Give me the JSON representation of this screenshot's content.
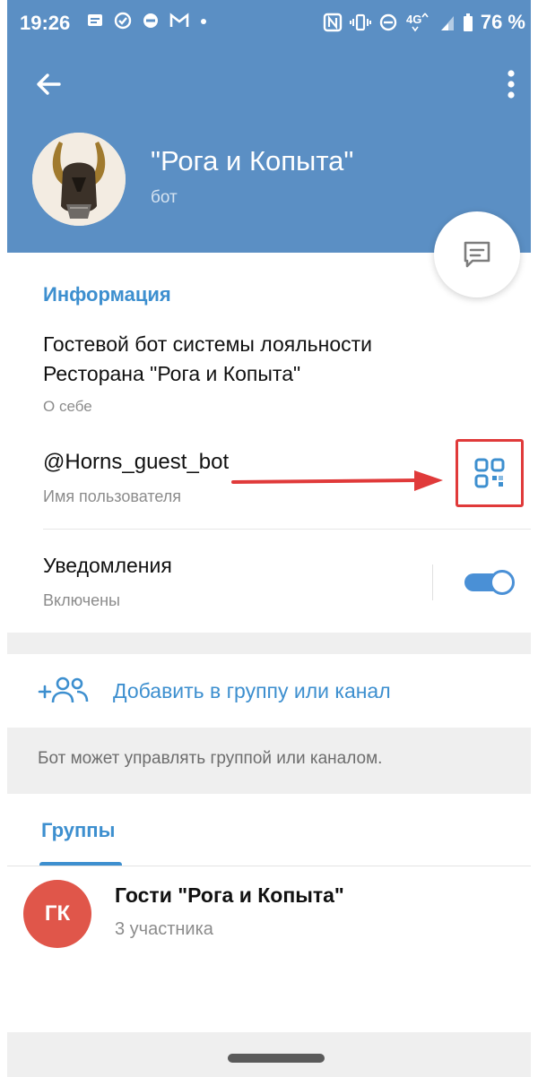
{
  "status_bar": {
    "time": "19:26",
    "battery": "76 %",
    "icons": [
      "message-icon",
      "check-circle-icon",
      "minus-circle-icon",
      "gmail-icon",
      "dot-icon",
      "nfc-icon",
      "vibrate-icon",
      "dnd-icon",
      "4g-icon",
      "signal-icon",
      "battery-icon"
    ]
  },
  "header": {
    "bot_name": "\"Рога и Копыта\"",
    "bot_subtitle": "бот"
  },
  "info": {
    "section_title": "Информация",
    "about_text": "Гостевой бот системы лояльности Ресторана \"Рога и Копыта\"",
    "about_label": "О себе",
    "username": "@Horns_guest_bot",
    "username_label": "Имя пользователя"
  },
  "notifications": {
    "title": "Уведомления",
    "status": "Включены",
    "enabled": true
  },
  "add_to_group": {
    "label": "Добавить в группу или канал",
    "hint": "Бот может управлять группой или каналом."
  },
  "groups": {
    "tab_label": "Группы",
    "items": [
      {
        "initials": "ГК",
        "name": "Гости \"Рога и Копыта\"",
        "members": "3 участника"
      }
    ]
  },
  "colors": {
    "header_bg": "#5b8fc4",
    "accent": "#3d8fcf",
    "highlight_red": "#e03a3a",
    "group_avatar": "#e0564a"
  }
}
